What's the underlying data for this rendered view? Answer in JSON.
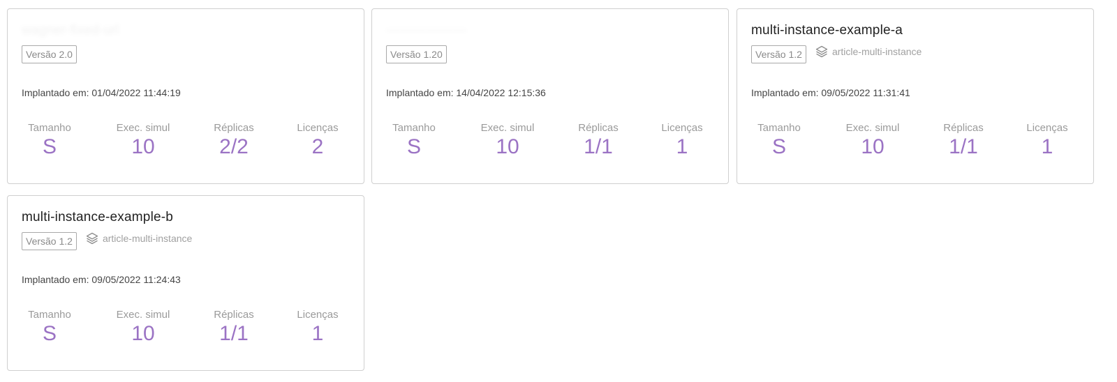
{
  "cards": [
    {
      "title": "wagner-fixed-url",
      "title_blurred": true,
      "version": "Versão 2.0",
      "group": "",
      "deployed": "Implantado em: 01/04/2022 11:44:19",
      "stats": [
        {
          "label": "Tamanho",
          "value": "S"
        },
        {
          "label": "Exec. simul",
          "value": "10"
        },
        {
          "label": "Réplicas",
          "value": "2/2"
        },
        {
          "label": "Licenças",
          "value": "2"
        }
      ]
    },
    {
      "title": "——————",
      "title_blurred": true,
      "version": "Versão 1.20",
      "group": "",
      "deployed": "Implantado em: 14/04/2022 12:15:36",
      "stats": [
        {
          "label": "Tamanho",
          "value": "S"
        },
        {
          "label": "Exec. simul",
          "value": "10"
        },
        {
          "label": "Réplicas",
          "value": "1/1"
        },
        {
          "label": "Licenças",
          "value": "1"
        }
      ]
    },
    {
      "title": "multi-instance-example-a",
      "title_blurred": false,
      "version": "Versão 1.2",
      "group": "article-multi-instance",
      "deployed": "Implantado em: 09/05/2022 11:31:41",
      "stats": [
        {
          "label": "Tamanho",
          "value": "S"
        },
        {
          "label": "Exec. simul",
          "value": "10"
        },
        {
          "label": "Réplicas",
          "value": "1/1"
        },
        {
          "label": "Licenças",
          "value": "1"
        }
      ]
    },
    {
      "title": "multi-instance-example-b",
      "title_blurred": false,
      "version": "Versão 1.2",
      "group": "article-multi-instance",
      "deployed": "Implantado em: 09/05/2022 11:24:43",
      "stats": [
        {
          "label": "Tamanho",
          "value": "S"
        },
        {
          "label": "Exec. simul",
          "value": "10"
        },
        {
          "label": "Réplicas",
          "value": "1/1"
        },
        {
          "label": "Licenças",
          "value": "1"
        }
      ]
    }
  ],
  "icons": {
    "group": "layers-icon"
  },
  "colors": {
    "stat_value": "#9b73c4",
    "border": "#cfcfcf"
  }
}
